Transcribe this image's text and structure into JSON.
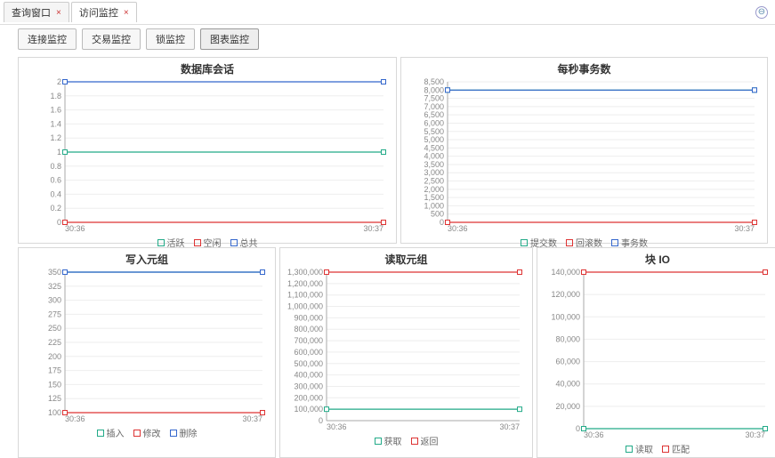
{
  "tabs": [
    {
      "label": "查询窗口",
      "closable": true,
      "active": false
    },
    {
      "label": "访问监控",
      "closable": true,
      "active": true
    }
  ],
  "subtabs": [
    {
      "label": "连接监控",
      "active": false
    },
    {
      "label": "交易监控",
      "active": false
    },
    {
      "label": "锁监控",
      "active": false
    },
    {
      "label": "图表监控",
      "active": true
    }
  ],
  "chart_data": [
    {
      "type": "line",
      "title": "数据库会话",
      "x": [
        "30:36",
        "30:37"
      ],
      "ylim": [
        0,
        2.0
      ],
      "yticks": [
        0,
        0.2,
        0.4,
        0.6,
        0.8,
        1.0,
        1.2,
        1.4,
        1.6,
        1.8,
        2.0
      ],
      "series": [
        {
          "name": "活跃",
          "color": "#2a8",
          "values": [
            1.0,
            1.0
          ]
        },
        {
          "name": "空闲",
          "color": "#d33",
          "values": [
            0.0,
            0.0
          ]
        },
        {
          "name": "总共",
          "color": "#36c",
          "values": [
            2.0,
            2.0
          ]
        }
      ]
    },
    {
      "type": "line",
      "title": "每秒事务数",
      "x": [
        "30:36",
        "30:37"
      ],
      "ylim": [
        0,
        8500
      ],
      "yticks": [
        0,
        500,
        1000,
        1500,
        2000,
        2500,
        3000,
        3500,
        4000,
        4500,
        5000,
        5500,
        6000,
        6500,
        7000,
        7500,
        8000,
        8500
      ],
      "series": [
        {
          "name": "提交数",
          "color": "#2a8",
          "values": [
            8000,
            8000
          ]
        },
        {
          "name": "回滚数",
          "color": "#d33",
          "values": [
            0,
            0
          ]
        },
        {
          "name": "事务数",
          "color": "#36c",
          "values": [
            8000,
            8000
          ]
        }
      ]
    },
    {
      "type": "line",
      "title": "写入元组",
      "x": [
        "30:36",
        "30:37"
      ],
      "ylim": [
        100,
        350
      ],
      "yticks": [
        100,
        125,
        150,
        175,
        200,
        225,
        250,
        275,
        300,
        325,
        350
      ],
      "series": [
        {
          "name": "插入",
          "color": "#2a8",
          "values": [
            350,
            350
          ]
        },
        {
          "name": "修改",
          "color": "#d33",
          "values": [
            100,
            100
          ]
        },
        {
          "name": "删除",
          "color": "#36c",
          "values": [
            350,
            350
          ]
        }
      ]
    },
    {
      "type": "line",
      "title": "读取元组",
      "x": [
        "30:36",
        "30:37"
      ],
      "ylim": [
        0,
        1300000
      ],
      "yticks": [
        0,
        100000,
        200000,
        300000,
        400000,
        500000,
        600000,
        700000,
        800000,
        900000,
        1000000,
        1100000,
        1200000,
        1300000
      ],
      "series": [
        {
          "name": "获取",
          "color": "#2a8",
          "values": [
            100000,
            100000
          ]
        },
        {
          "name": "返回",
          "color": "#d33",
          "values": [
            1300000,
            1300000
          ]
        }
      ]
    },
    {
      "type": "line",
      "title": "块 IO",
      "x": [
        "30:36",
        "30:37"
      ],
      "ylim": [
        0,
        140000
      ],
      "yticks": [
        0,
        20000,
        40000,
        60000,
        80000,
        100000,
        120000,
        140000
      ],
      "series": [
        {
          "name": "读取",
          "color": "#2a8",
          "values": [
            0,
            0
          ]
        },
        {
          "name": "匹配",
          "color": "#d33",
          "values": [
            140000,
            140000
          ]
        }
      ]
    }
  ]
}
